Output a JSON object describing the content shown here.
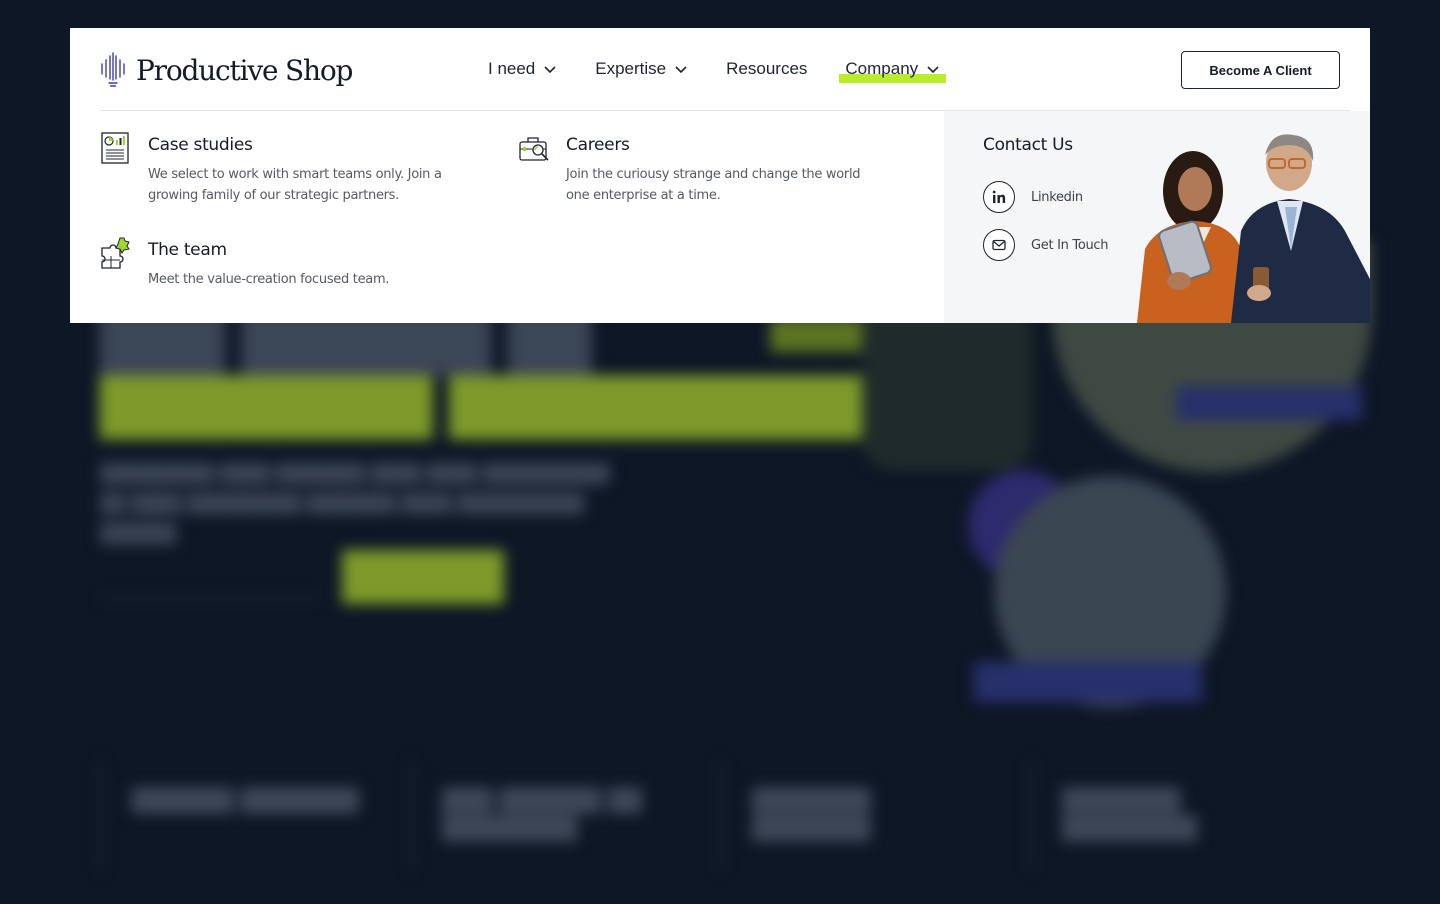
{
  "nav": {
    "brand": "Productive Shop",
    "items": [
      {
        "label": "I need",
        "has_caret": true
      },
      {
        "label": "Expertise",
        "has_caret": true
      },
      {
        "label": "Resources",
        "has_caret": false
      },
      {
        "label": "Company",
        "has_caret": true,
        "active": true
      }
    ],
    "cta_label": "Become A Client",
    "accent_color": "#b9ec2b"
  },
  "company_menu": {
    "items": [
      {
        "title": "Case studies",
        "description": "We select to work with smart teams only. Join a growing family of our strategic partners.",
        "icon": "report-chart-icon"
      },
      {
        "title": "Careers",
        "description": "Join the curiousy strange and change the world one enterprise at a time.",
        "icon": "briefcase-search-icon"
      },
      {
        "title": "The team",
        "description": "Meet the value-creation focused team.",
        "icon": "puzzle-team-icon"
      }
    ],
    "contact": {
      "title": "Contact Us",
      "links": [
        {
          "label": "Linkedin",
          "icon": "linkedin-icon"
        },
        {
          "label": "Get In Touch",
          "icon": "mail-icon"
        }
      ]
    }
  }
}
